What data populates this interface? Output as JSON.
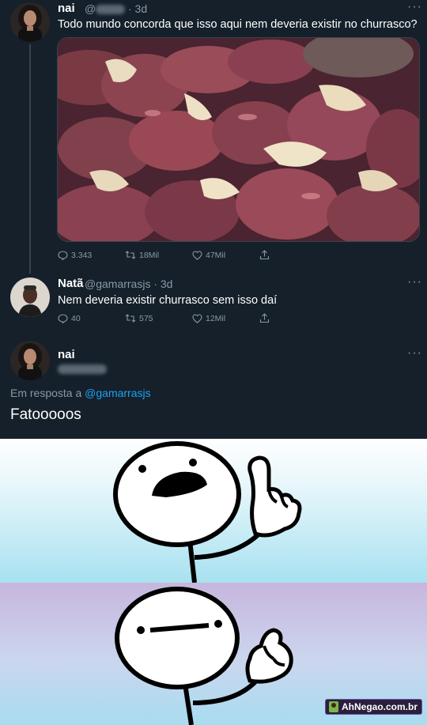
{
  "tweet1": {
    "name": "nai",
    "handle_visible": "@",
    "dot_time": "· 3d",
    "text": "Todo mundo concorda que isso aqui nem deveria existir no churrasco?",
    "replies": "3.343",
    "retweets": "18Mil",
    "likes": "47Mil"
  },
  "tweet2": {
    "name": "Natã",
    "handle_time": "@gamarrasjs · 3d",
    "text": "Nem deveria existir churrasco sem isso daí",
    "replies": "40",
    "retweets": "575",
    "likes": "12Mil"
  },
  "tweet3": {
    "name": "nai",
    "reply_prefix": "Em resposta a",
    "reply_link": "@gamarrasjs",
    "text": "Fatooooos"
  },
  "more_label": "···",
  "watermark": "AhNegao.com.br",
  "colors": {
    "background": "#15202b",
    "secondary_text": "#8899a6",
    "link": "#1da1f2"
  }
}
